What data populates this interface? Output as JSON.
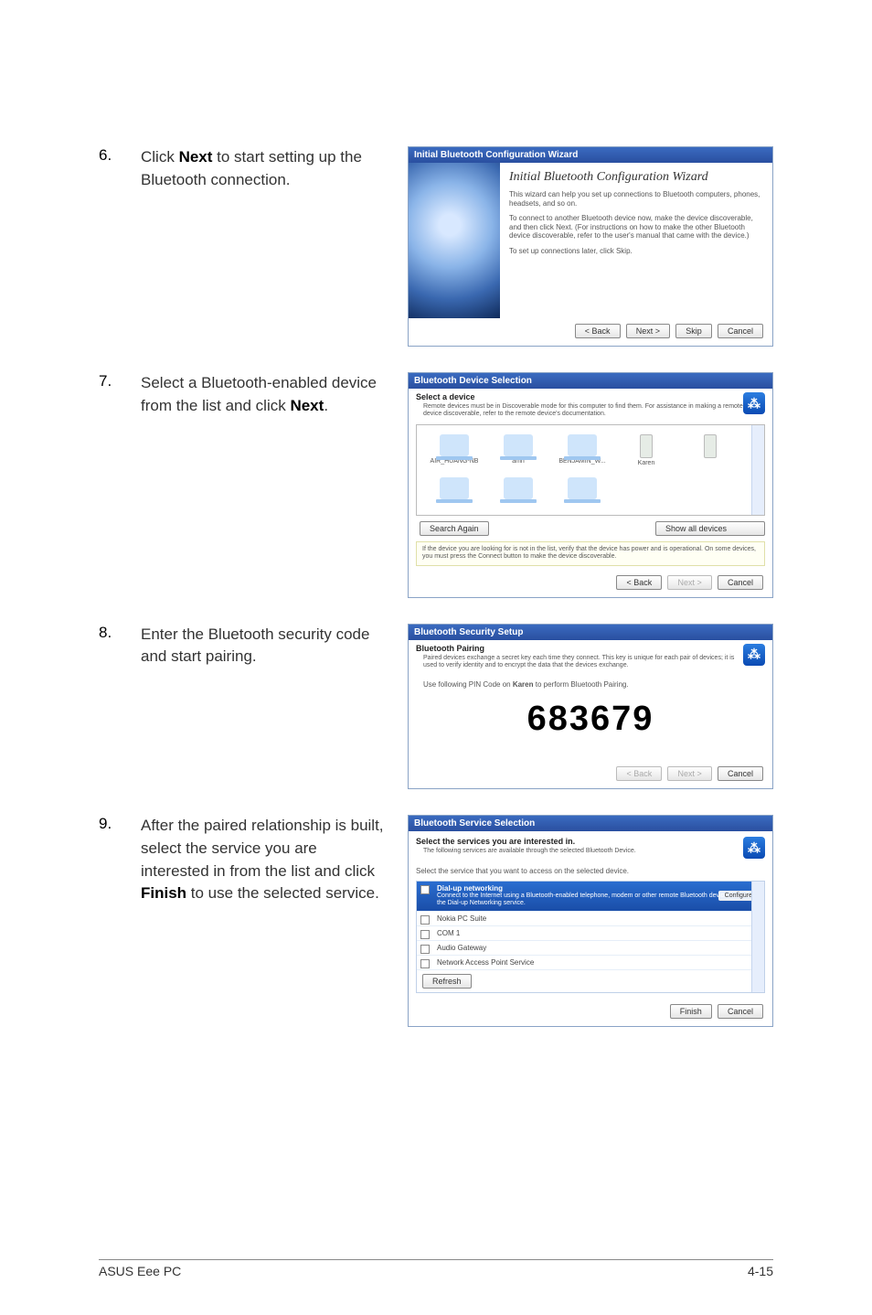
{
  "steps": [
    {
      "num": "6.",
      "pre": "Click ",
      "bold": "Next",
      "post": " to start setting up the Bluetooth connection."
    },
    {
      "num": "7.",
      "pre": "Select a Bluetooth-enabled device from the list and click ",
      "bold": "Next",
      "post": "."
    },
    {
      "num": "8.",
      "pre": "Enter the Bluetooth security code and start pairing.",
      "bold": "",
      "post": ""
    },
    {
      "num": "9.",
      "pre": "After the paired relationship is built, select the service you are interested in from the list and click ",
      "bold": "Finish",
      "post": " to use the selected service."
    }
  ],
  "d6": {
    "titlebar": "Initial Bluetooth Configuration Wizard",
    "heading": "Initial Bluetooth Configuration Wizard",
    "p1": "This wizard can help you set up connections to Bluetooth computers, phones, headsets, and so on.",
    "p2": "To connect to another Bluetooth device now, make the device discoverable, and then click Next. (For instructions on how to make the other Bluetooth device discoverable, refer to the user's manual that came with the device.)",
    "p3": "To set up connections later, click Skip.",
    "btn_back": "< Back",
    "btn_next": "Next >",
    "btn_skip": "Skip",
    "btn_cancel": "Cancel"
  },
  "d7": {
    "titlebar": "Bluetooth Device Selection",
    "header": "Select a device",
    "sub": "Remote devices must be in Discoverable mode for this computer to find them. For assistance in making a remote device discoverable, refer to the remote device's documentation.",
    "devices": [
      "AIR_HUANG-NB",
      "amn",
      "BENJAMIN_W...",
      "Karen",
      "",
      "",
      "",
      ""
    ],
    "btn_search": "Search Again",
    "dd_show": "Show all devices",
    "note": "If the device you are looking for is not in the list, verify that the device has power and is operational. On some devices, you must press the Connect button to make the device discoverable.",
    "btn_back": "< Back",
    "btn_next": "Next >",
    "btn_cancel": "Cancel"
  },
  "d8": {
    "titlebar": "Bluetooth Security Setup",
    "header": "Bluetooth Pairing",
    "sub": "Paired devices exchange a secret key each time they connect. This key is unique for each pair of devices; it is used to verify identity and to encrypt the data that the devices exchange.",
    "instr_pre": "Use following PIN Code on ",
    "instr_dev": "Karen",
    "instr_post": " to perform Bluetooth Pairing.",
    "pin": "683679",
    "btn_back": "< Back",
    "btn_next": "Next >",
    "btn_cancel": "Cancel"
  },
  "d9": {
    "titlebar": "Bluetooth Service Selection",
    "header": "Select the services you are interested in.",
    "sub": "The following services are available through the selected Bluetooth Device.",
    "list_hdr": "Select the service that you want to access on the selected device.",
    "services": [
      {
        "title": "Dial-up networking",
        "desc": "Connect to the Internet using a Bluetooth-enabled telephone, modem or other remote Bluetooth device that offers the Dial-up Networking service.",
        "selected": true,
        "configure": "Configure"
      },
      {
        "title": "Nokia PC Suite",
        "desc": "",
        "selected": false
      },
      {
        "title": "COM 1",
        "desc": "",
        "selected": false
      },
      {
        "title": "Audio Gateway",
        "desc": "",
        "selected": false
      },
      {
        "title": "Network Access Point Service",
        "desc": "",
        "selected": false
      }
    ],
    "btn_refresh": "Refresh",
    "btn_finish": "Finish",
    "btn_cancel": "Cancel"
  },
  "footer": {
    "left": "ASUS Eee PC",
    "right": "4-15"
  }
}
